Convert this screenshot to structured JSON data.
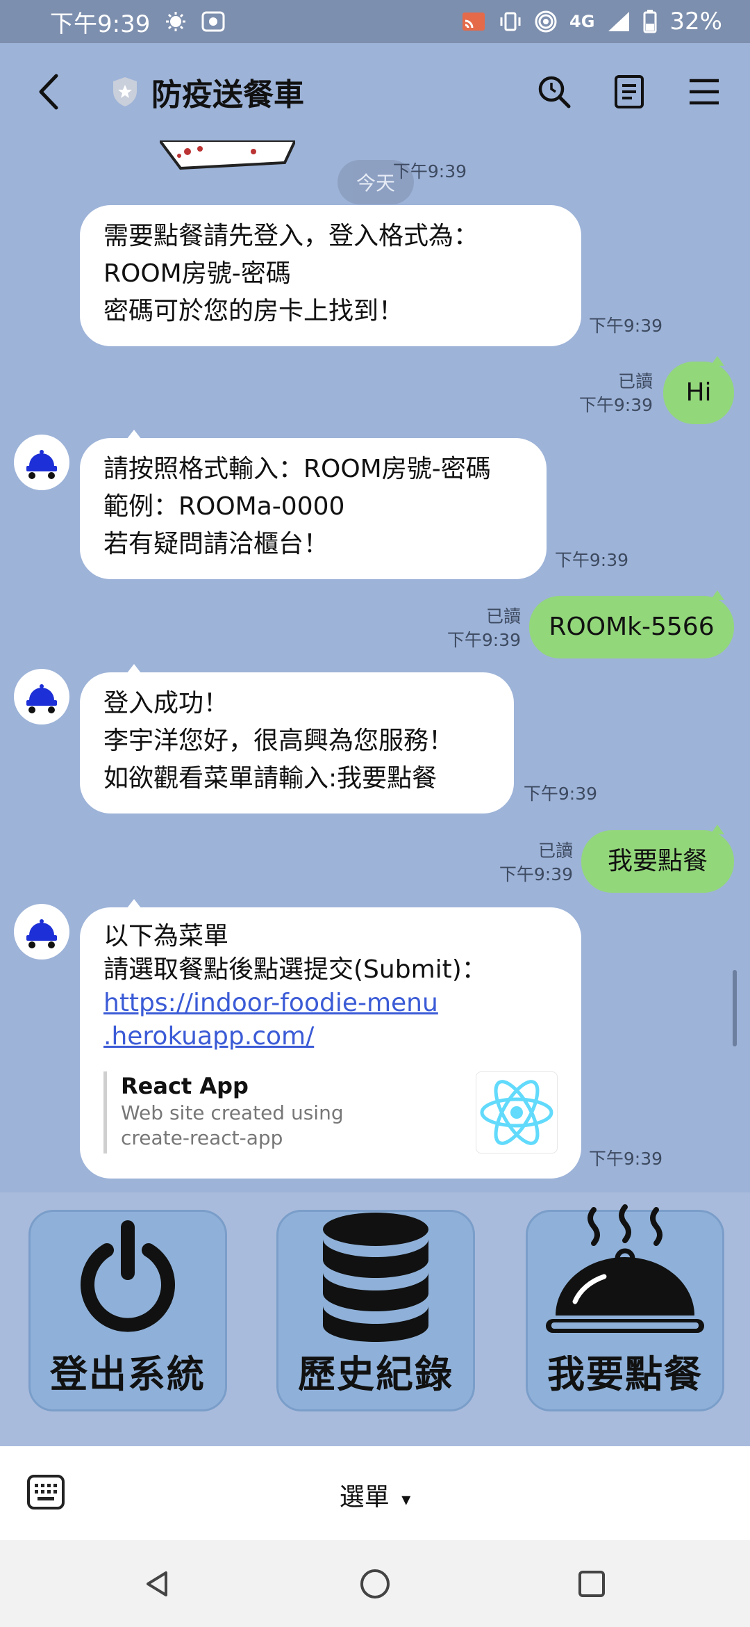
{
  "status_bar": {
    "time": "下午9:39",
    "network": "4G",
    "battery": "32%"
  },
  "header": {
    "title": "防疫送餐車",
    "icons": [
      "back-icon",
      "shield-icon",
      "search-icon",
      "notes-icon",
      "menu-icon"
    ]
  },
  "chat": {
    "date_label": "今天",
    "messages": [
      {
        "from": "bot",
        "lines": [
          "需要點餐請先登入，登入格式為：",
          "ROOM房號-密碼",
          "密碼可於您的房卡上找到！"
        ],
        "time": "下午9:39"
      },
      {
        "from": "me",
        "text": "Hi",
        "read": "已讀",
        "time": "下午9:39"
      },
      {
        "from": "bot",
        "lines": [
          "請按照格式輸入：ROOM房號-密碼",
          "範例：ROOMa-0000",
          "若有疑問請洽櫃台！"
        ],
        "time": "下午9:39"
      },
      {
        "from": "me",
        "text": "ROOMk-5566",
        "read": "已讀",
        "time": "下午9:39"
      },
      {
        "from": "bot",
        "lines": [
          "登入成功！",
          "李宇洋您好，很高興為您服務！",
          "如欲觀看菜單請輸入:我要點餐"
        ],
        "time": "下午9:39"
      },
      {
        "from": "me",
        "text": "我要點餐",
        "read": "已讀",
        "time": "下午9:39"
      },
      {
        "from": "bot",
        "lines": [
          "以下為菜單",
          "請選取餐點後點選提交(Submit)："
        ],
        "link_lines": [
          "https://indoor-foodie-menu",
          ".herokuapp.com/"
        ],
        "preview": {
          "title": "React App",
          "desc_lines": [
            "Web site created using",
            "create-react-app"
          ]
        },
        "time": "下午9:39"
      }
    ]
  },
  "rich_menu": {
    "buttons": [
      {
        "label": "登出系統",
        "icon": "power-icon"
      },
      {
        "label": "歷史紀錄",
        "icon": "database-icon"
      },
      {
        "label": "我要點餐",
        "icon": "cloche-icon"
      }
    ]
  },
  "bottom_bar": {
    "menu_label": "選單",
    "menu_caret": "▾"
  },
  "colors": {
    "chat_bg": "#9db3d8",
    "my_bubble": "#93d77b",
    "bot_bubble": "#ffffff",
    "rich_button": "#8fb1d9",
    "link": "#3b5bd6"
  }
}
